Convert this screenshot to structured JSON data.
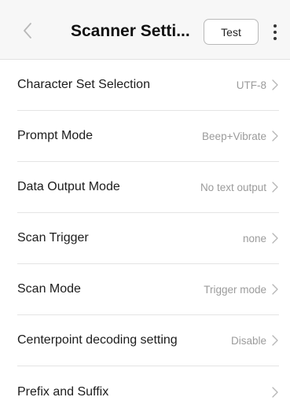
{
  "header": {
    "title": "Scanner Setti...",
    "test_label": "Test",
    "back_icon": "chevron-left-icon",
    "more_icon": "more-vertical-icon"
  },
  "colors": {
    "header_bg": "#f7f7f7",
    "value_text": "#9b9b9b",
    "divider": "#e4e4e4"
  },
  "settings": [
    {
      "label": "Character Set Selection",
      "value": "UTF-8"
    },
    {
      "label": "Prompt Mode",
      "value": "Beep+Vibrate"
    },
    {
      "label": "Data Output Mode",
      "value": "No text output"
    },
    {
      "label": "Scan Trigger",
      "value": "none"
    },
    {
      "label": "Scan Mode",
      "value": "Trigger mode"
    },
    {
      "label": "Centerpoint decoding setting",
      "value": "Disable"
    },
    {
      "label": "Prefix and Suffix",
      "value": ""
    }
  ]
}
